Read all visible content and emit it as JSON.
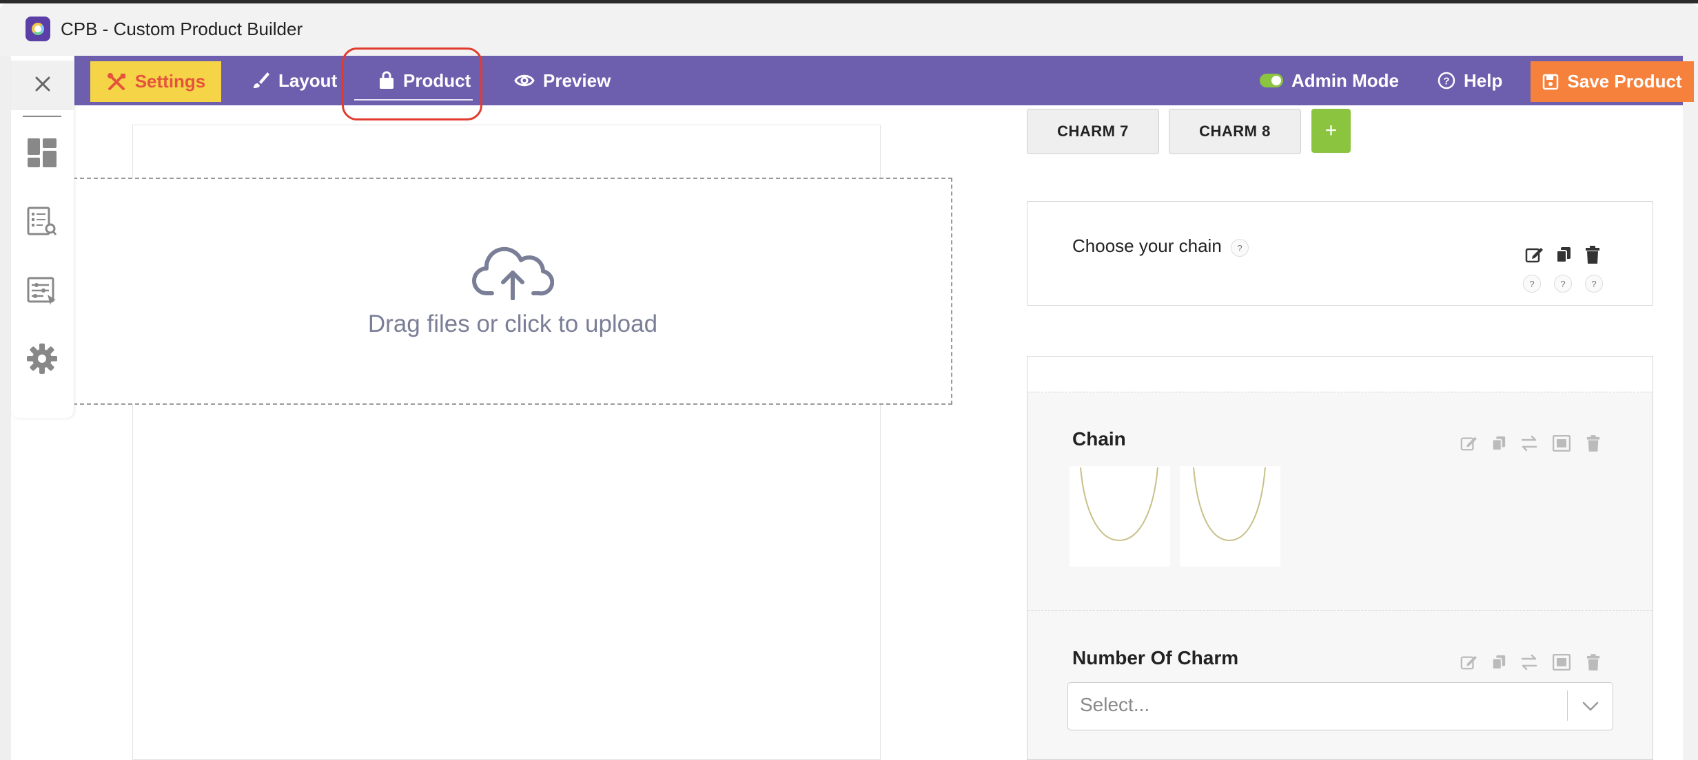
{
  "window": {
    "title": "CPB - Custom Product Builder"
  },
  "nav": {
    "settings": "Settings",
    "layout": "Layout",
    "product": "Product",
    "preview": "Preview",
    "admin_mode": "Admin Mode",
    "help": "Help",
    "save_product": "Save Product"
  },
  "colors": {
    "nav_bg": "#6d5fae",
    "settings_bg": "#f5d547",
    "settings_text": "#e5533c",
    "save_bg": "#f5813c",
    "add_button": "#8bc53f",
    "highlight": "#e23b2e"
  },
  "sidebar": {
    "icons": [
      "close-icon",
      "dashboard-icon",
      "list-search-icon",
      "filter-settings-icon",
      "gear-icon"
    ]
  },
  "upload": {
    "text": "Drag files or click to upload"
  },
  "charms": {
    "tabs": [
      "CHARM 7",
      "CHARM 8"
    ],
    "add": "+"
  },
  "chain_section": {
    "title": "Choose your chain",
    "help": "?"
  },
  "fields": {
    "chain": {
      "label": "Chain"
    },
    "number_of_charm": {
      "label": "Number Of Charm",
      "placeholder": "Select..."
    }
  }
}
